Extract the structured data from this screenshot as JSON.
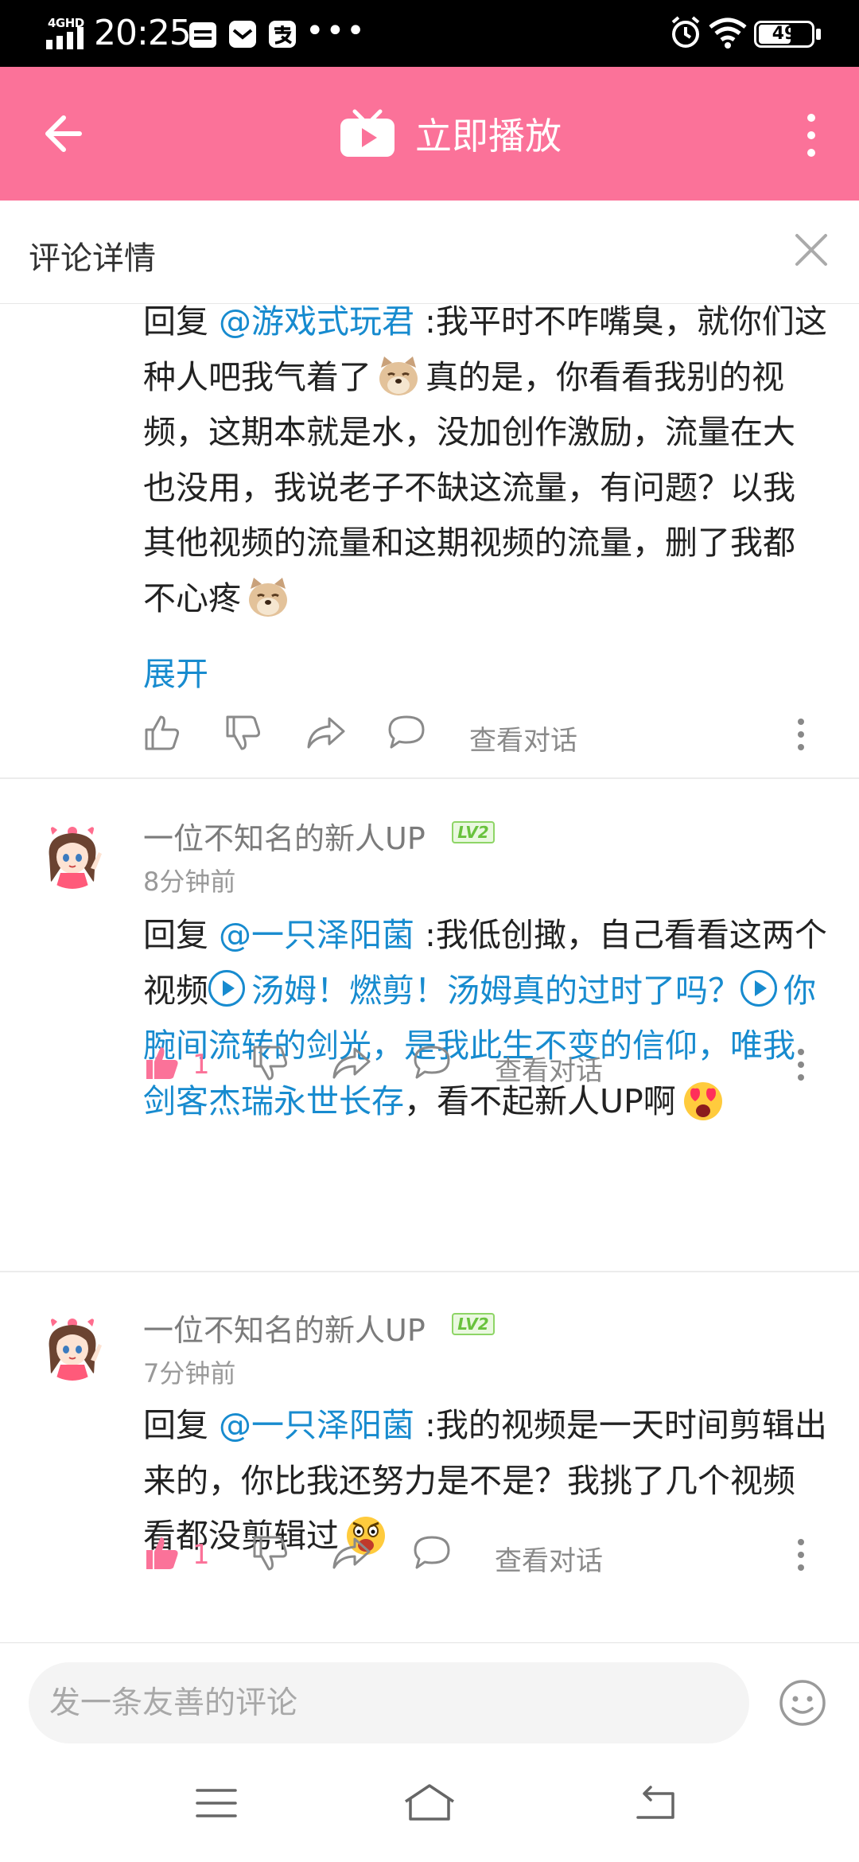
{
  "status_bar": {
    "network": "4GHD",
    "time": "20:25",
    "battery": "49",
    "overflow": "•••"
  },
  "header": {
    "title": "立即播放"
  },
  "section": {
    "title": "评论详情"
  },
  "colors": {
    "brand_pink": "#fb7299",
    "link_blue": "#178bcf"
  },
  "comments": [
    {
      "reply_prefix": "回复 ",
      "mention": "@游戏式玩君",
      "text_1": " :我平时不咋嘴臭，就你们这种人吧我气着了",
      "text_2": "真的是，你看看我别的视频，这期本就是水，没加创作激励，流量在大也没用，我说老子不缺这流量，有问题？以我其他视频的流量和这期视频的流量，删了我都不心疼",
      "expand_label": "展开",
      "view_conversation": "查看对话"
    },
    {
      "username": "一位不知名的新人UP",
      "level": "LV2",
      "time": "8分钟前",
      "reply_prefix": "回复 ",
      "mention": "@一只泽阳菌",
      "text_1": " :我低创撖，自己看看这两个视频",
      "video_1": "汤姆！燃剪！汤姆真的过时了吗？",
      "video_2": "你腕间流转的剑光，是我此生不变的信仰，唯我剑客杰瑞永世长存",
      "text_2": "，看不起新人UP啊",
      "likes": "1",
      "view_conversation": "查看对话"
    },
    {
      "username": "一位不知名的新人UP",
      "level": "LV2",
      "time": "7分钟前",
      "reply_prefix": "回复 ",
      "mention": "@一只泽阳菌",
      "text_1": " :我的视频是一天时间剪辑出来的，你比我还努力是不是？我挑了几个视频看都没剪辑过",
      "likes": "1",
      "view_conversation": "查看对话"
    }
  ],
  "input": {
    "placeholder": "发一条友善的评论"
  }
}
